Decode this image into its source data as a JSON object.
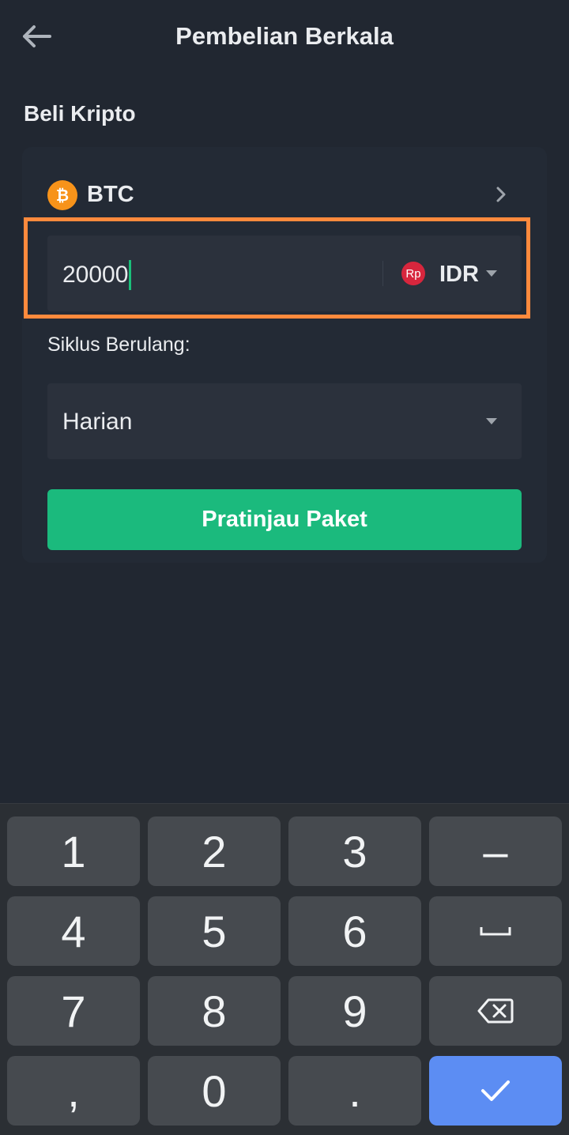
{
  "header": {
    "title": "Pembelian Berkala",
    "back_icon": "arrow-left-icon"
  },
  "section": {
    "title": "Beli Kripto"
  },
  "asset": {
    "symbol": "BTC",
    "icon": "bitcoin-icon",
    "icon_glyph": "₿",
    "icon_color": "#f7931a"
  },
  "amount": {
    "value": "20000",
    "currency": "IDR",
    "currency_icon_text": "Rp",
    "currency_icon_color": "#d7263d",
    "highlight_color": "#ff8a3d"
  },
  "cycle": {
    "label": "Siklus Berulang:",
    "value": "Harian"
  },
  "preview_button": {
    "label": "Pratinjau Paket",
    "color": "#1bba7d"
  },
  "keyboard": {
    "keys": [
      "1",
      "2",
      "3",
      "–",
      "4",
      "5",
      "6",
      "space",
      "7",
      "8",
      "9",
      "backspace",
      ",",
      "0",
      ".",
      "done"
    ],
    "key_1": "1",
    "key_2": "2",
    "key_3": "3",
    "key_minus": "–",
    "key_4": "4",
    "key_5": "5",
    "key_6": "6",
    "key_7": "7",
    "key_8": "8",
    "key_9": "9",
    "key_comma": ",",
    "key_0": "0",
    "key_period": ".",
    "done_color": "#5c8df3"
  }
}
